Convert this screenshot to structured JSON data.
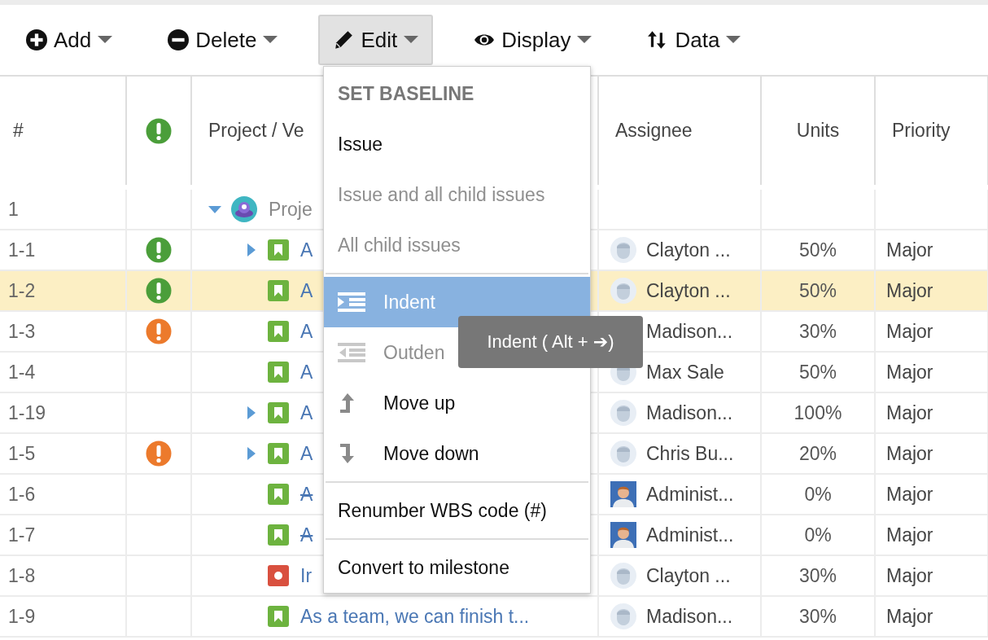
{
  "toolbar": [
    {
      "label": "Add",
      "selected": false
    },
    {
      "label": "Delete",
      "selected": false
    },
    {
      "label": "Edit",
      "selected": true
    },
    {
      "label": "Display",
      "selected": false
    },
    {
      "label": "Data",
      "selected": false
    }
  ],
  "table": {
    "columns": [
      {
        "kind": "text",
        "label": "#"
      },
      {
        "kind": "alert-icon"
      },
      {
        "kind": "text",
        "label": "Project / Ve"
      },
      {
        "kind": "text",
        "label": "Assignee"
      },
      {
        "kind": "centered-text",
        "label": "Units"
      },
      {
        "kind": "text",
        "label": "Priority"
      }
    ],
    "rows": [
      {
        "number": "1",
        "selected": false,
        "expanded": true,
        "kind": "project",
        "title": "Proje",
        "children": [
          {
            "number": "1-1",
            "selected": false,
            "color": "#4b9e3a",
            "expanded": false,
            "kind": "story",
            "title": "A",
            "resolved": false,
            "assignee": {
              "kind": "default",
              "name": "Clayton ..."
            },
            "units": "50%",
            "priority": "Major"
          },
          {
            "number": "1-2",
            "selected": true,
            "color": "#4b9e3a",
            "kind": "story",
            "title": "A",
            "resolved": false,
            "assignee": {
              "kind": "default",
              "name": "Clayton ..."
            },
            "units": "50%",
            "priority": "Major"
          },
          {
            "number": "1-3",
            "selected": false,
            "color": "#ec7a2c",
            "kind": "story",
            "title": "A",
            "resolved": false,
            "assignee": {
              "name": "Madison..."
            },
            "units": "30%",
            "priority": "Major"
          },
          {
            "number": "1-4",
            "selected": false,
            "kind": "story",
            "title": "A",
            "resolved": false,
            "assignee": {
              "kind": "default",
              "name": "Max Sale"
            },
            "units": "50%",
            "priority": "Major"
          },
          {
            "number": "1-19",
            "selected": false,
            "expanded": false,
            "kind": "story",
            "title": "A",
            "resolved": false,
            "assignee": {
              "kind": "default",
              "name": "Madison..."
            },
            "units": "100%",
            "priority": "Major"
          },
          {
            "number": "1-5",
            "selected": false,
            "color": "#ec7a2c",
            "expanded": false,
            "kind": "story",
            "title": "A",
            "resolved": false,
            "assignee": {
              "kind": "default",
              "name": "Chris Bu..."
            },
            "units": "20%",
            "priority": "Major"
          },
          {
            "number": "1-6",
            "selected": false,
            "kind": "story",
            "title": "A",
            "resolved": true,
            "assignee": {
              "kind": "photo",
              "name": "Administ..."
            },
            "units": "0%",
            "priority": "Major"
          },
          {
            "number": "1-7",
            "selected": false,
            "kind": "story",
            "title": "A",
            "resolved": true,
            "assignee": {
              "kind": "photo",
              "name": "Administ..."
            },
            "units": "0%",
            "priority": "Major"
          },
          {
            "number": "1-8",
            "selected": false,
            "kind": "bug",
            "title": "Ir",
            "resolved": false,
            "assignee": {
              "kind": "default",
              "name": "Clayton ..."
            },
            "units": "30%",
            "priority": "Major"
          },
          {
            "number": "1-9",
            "selected": false,
            "kind": "story",
            "title": "As a team, we can finish t...",
            "resolved": false,
            "assignee": {
              "kind": "default",
              "name": "Madison..."
            },
            "units": "30%",
            "priority": "Major"
          }
        ]
      }
    ]
  },
  "edit_menu": {
    "items": [
      {
        "kind": "header",
        "label": "SET BASELINE"
      },
      {
        "kind": "plain",
        "label": "Issue",
        "disabled": false,
        "selected": false
      },
      {
        "kind": "plain",
        "label": "Issue and all child issues",
        "disabled": true,
        "selected": false
      },
      {
        "kind": "plain",
        "label": "All child issues",
        "disabled": true,
        "selected": false
      },
      {
        "kind": "separator"
      },
      {
        "kind": "indent",
        "label": "Indent",
        "disabled": false,
        "selected": true
      },
      {
        "kind": "outdent",
        "label": "Outden",
        "disabled": true,
        "selected": false
      },
      {
        "kind": "move-up",
        "label": "Move up",
        "disabled": false,
        "selected": false
      },
      {
        "kind": "move-down",
        "label": "Move down",
        "disabled": false,
        "selected": false
      },
      {
        "kind": "separator"
      },
      {
        "kind": "plain",
        "label": "Renumber WBS code (#)",
        "disabled": false,
        "selected": false
      },
      {
        "kind": "separator"
      },
      {
        "kind": "plain",
        "label": "Convert to milestone",
        "disabled": false,
        "selected": false
      }
    ]
  },
  "tooltip": {
    "text": "Indent ( Alt + ➔)"
  }
}
